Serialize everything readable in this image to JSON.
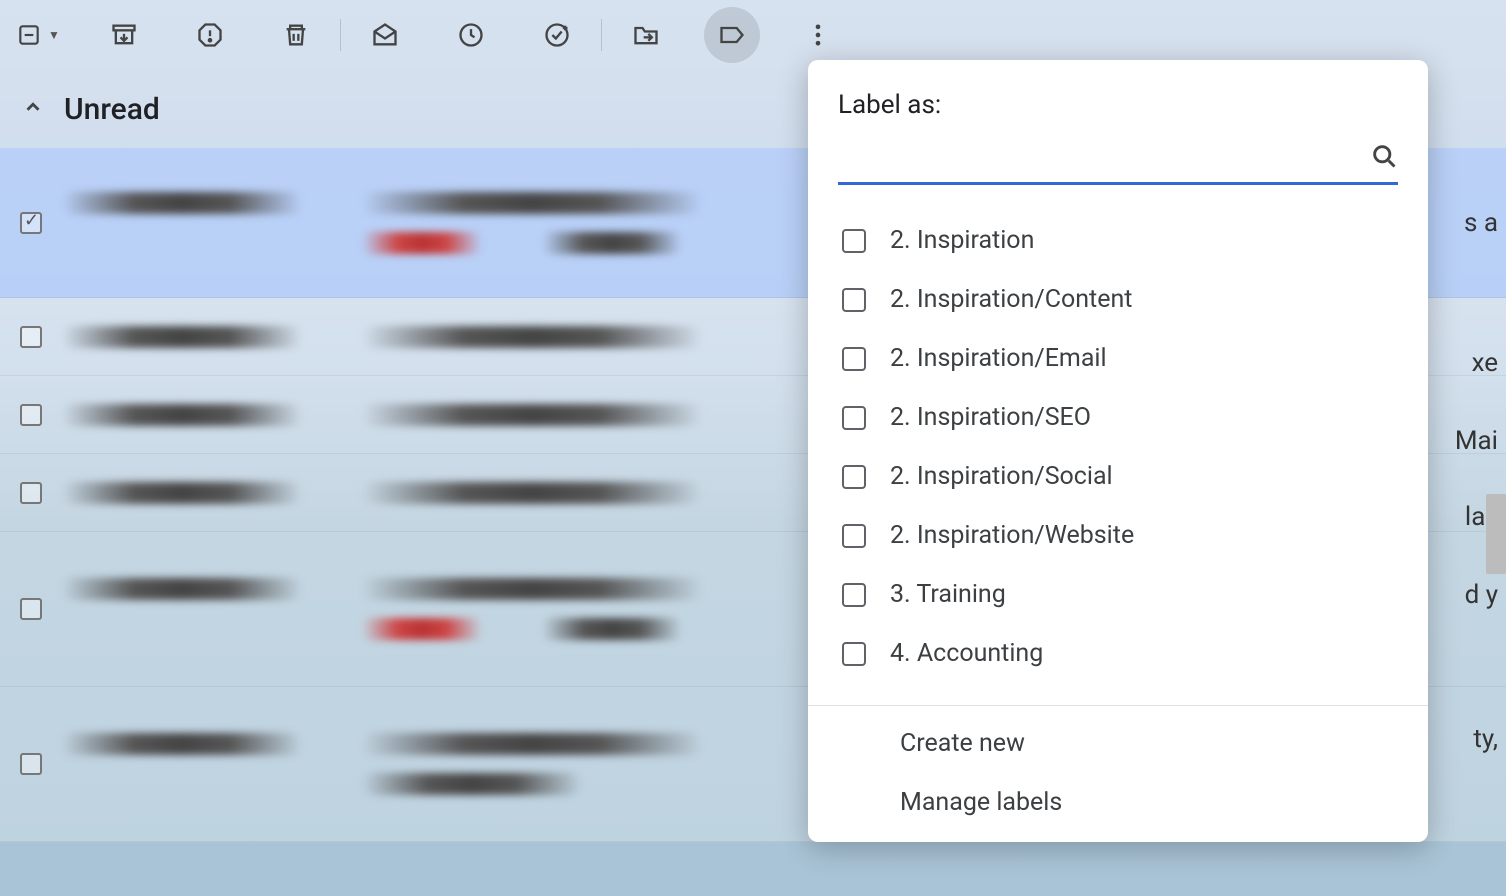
{
  "toolbar": {
    "select_icon": "select",
    "archive_icon": "archive",
    "spam_icon": "report-spam",
    "delete_icon": "delete",
    "markread_icon": "mark-read",
    "snooze_icon": "snooze",
    "task_icon": "add-task",
    "move_icon": "move-to",
    "label_icon": "label",
    "more_icon": "more"
  },
  "section": {
    "title": "Unread"
  },
  "rows": {
    "frag1": "s a",
    "frag2": "xe",
    "frag3": "Mai",
    "frag4": "lail",
    "frag5": "d y",
    "frag6": "ty,",
    "subj1": "ount",
    "subj2": "a-Acc",
    "subj3": "own",
    "subj4": "own",
    "subj5": "own",
    "subj6": "ounta",
    "subj7": "a-Acc",
    "subj8": "eting",
    "subj9": "ok-sig"
  },
  "label_popup": {
    "title": "Label as:",
    "search_placeholder": "",
    "items": [
      {
        "label": "2. Inspiration"
      },
      {
        "label": "2. Inspiration/Content"
      },
      {
        "label": "2. Inspiration/Email"
      },
      {
        "label": "2. Inspiration/SEO"
      },
      {
        "label": "2. Inspiration/Social"
      },
      {
        "label": "2. Inspiration/Website"
      },
      {
        "label": "3. Training"
      },
      {
        "label": "4. Accounting"
      }
    ],
    "create_new": "Create new",
    "manage": "Manage labels"
  }
}
